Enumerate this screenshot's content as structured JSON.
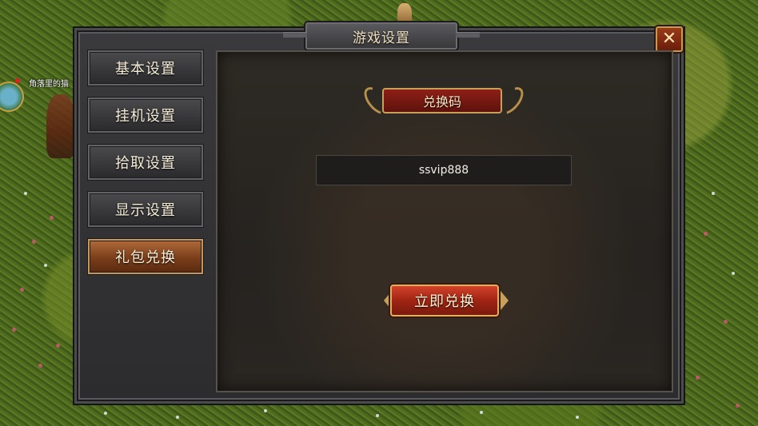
{
  "window": {
    "title": "游戏设置"
  },
  "player": {
    "name": "角落里的猫"
  },
  "sidebar": {
    "items": [
      {
        "label": "基本设置",
        "active": false
      },
      {
        "label": "挂机设置",
        "active": false
      },
      {
        "label": "拾取设置",
        "active": false
      },
      {
        "label": "显示设置",
        "active": false
      },
      {
        "label": "礼包兑换",
        "active": true
      }
    ]
  },
  "redeem": {
    "section_label": "兑换码",
    "code_value": "ssvip888",
    "button_label": "立即兑换"
  },
  "icons": {
    "close": "close-icon"
  },
  "colors": {
    "accent_gold": "#c9a05a",
    "active_tab": "#9a5028",
    "redeem_red": "#b02c18"
  }
}
